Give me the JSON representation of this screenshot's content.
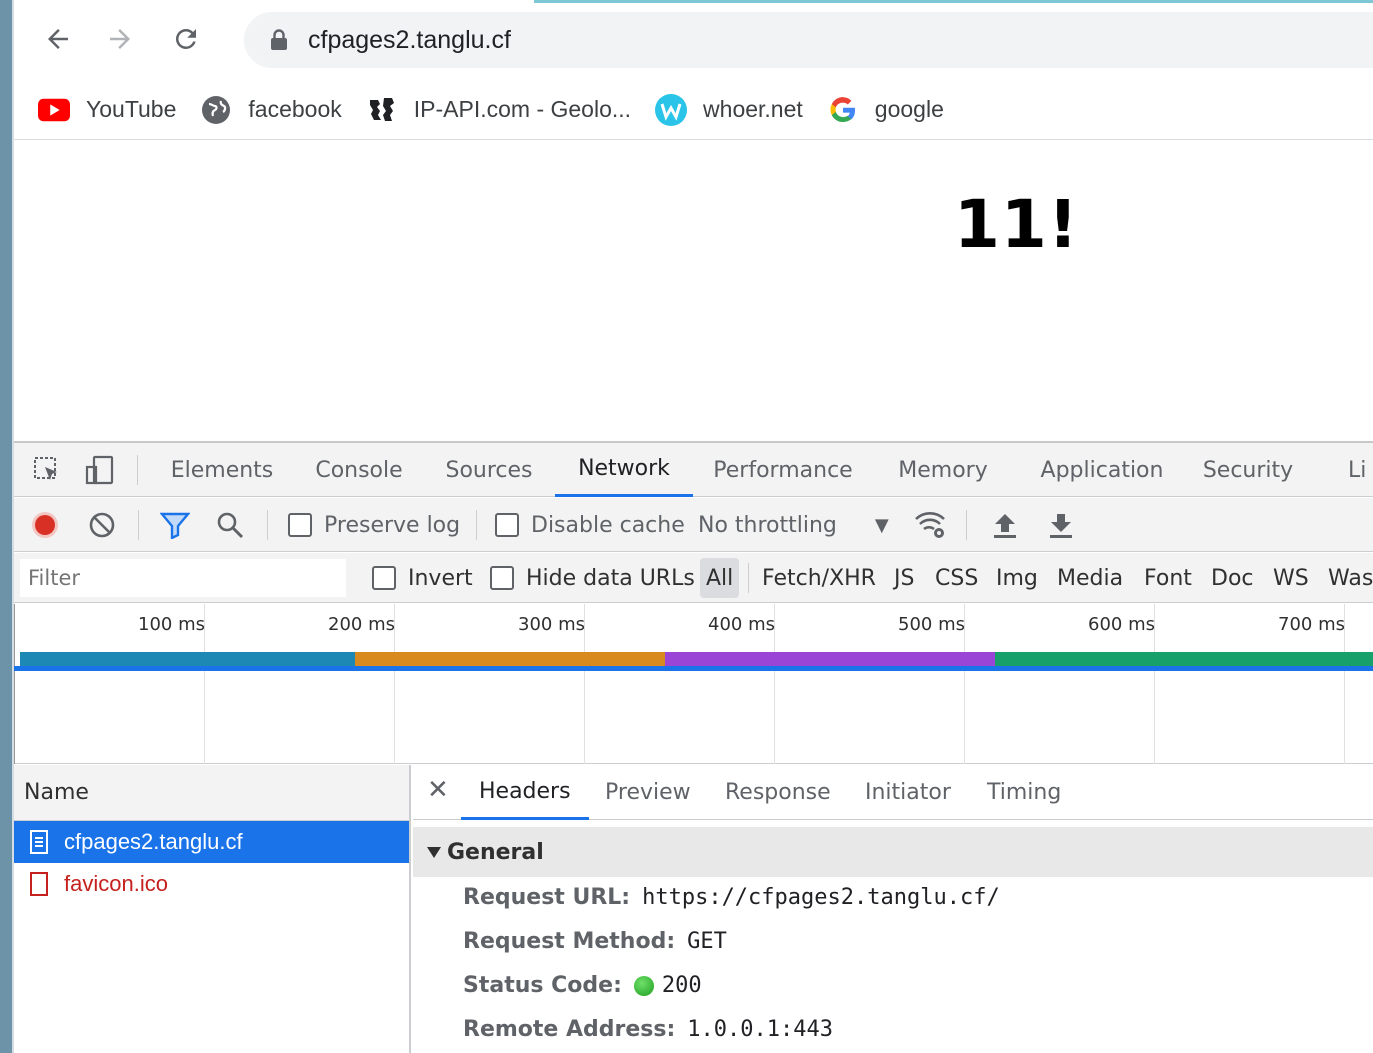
{
  "browser": {
    "url": "cfpages2.tanglu.cf",
    "bookmarks": [
      {
        "label": "YouTube",
        "icon": "youtube-icon"
      },
      {
        "label": "facebook",
        "icon": "globe-icon"
      },
      {
        "label": "IP-API.com - Geolo...",
        "icon": "ip-api-icon"
      },
      {
        "label": "whoer.net",
        "icon": "whoer-icon"
      },
      {
        "label": "google",
        "icon": "google-icon"
      }
    ]
  },
  "page": {
    "heading": "11!"
  },
  "devtools": {
    "tabs": [
      "Elements",
      "Console",
      "Sources",
      "Network",
      "Performance",
      "Memory",
      "Application",
      "Security",
      "Li"
    ],
    "active_tab": "Network",
    "toolbar": {
      "preserve_log": "Preserve log",
      "disable_cache": "Disable cache",
      "throttling": "No throttling"
    },
    "filter": {
      "placeholder": "Filter",
      "invert": "Invert",
      "hide_data_urls": "Hide data URLs",
      "types": [
        "All",
        "Fetch/XHR",
        "JS",
        "CSS",
        "Img",
        "Media",
        "Font",
        "Doc",
        "WS",
        "Was"
      ]
    },
    "timeline": {
      "ticks": [
        "100 ms",
        "200 ms",
        "300 ms",
        "400 ms",
        "500 ms",
        "600 ms",
        "700 ms"
      ],
      "colors": {
        "connect": "#1e88b5",
        "ssl": "#d98a1e",
        "waiting": "#9b45d6",
        "download": "#18a06a"
      }
    },
    "requests": {
      "header": "Name",
      "items": [
        {
          "name": "cfpages2.tanglu.cf",
          "selected": true
        },
        {
          "name": "favicon.ico",
          "error": true
        }
      ]
    },
    "detail": {
      "tabs": [
        "Headers",
        "Preview",
        "Response",
        "Initiator",
        "Timing"
      ],
      "active_tab": "Headers",
      "general_title": "General",
      "fields": {
        "request_url_label": "Request URL:",
        "request_url": "https://cfpages2.tanglu.cf/",
        "method_label": "Request Method:",
        "method": "GET",
        "status_label": "Status Code:",
        "status": "200",
        "remote_label": "Remote Address:",
        "remote": "1.0.0.1:443"
      }
    }
  }
}
